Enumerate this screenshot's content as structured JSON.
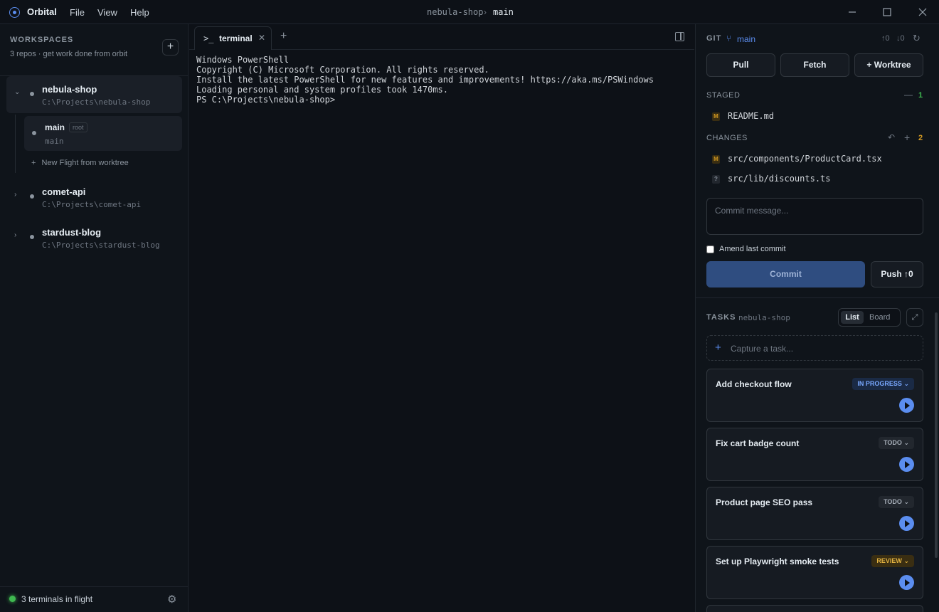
{
  "titlebar": {
    "app_name": "Orbital",
    "menus": [
      "File",
      "View",
      "Help"
    ],
    "breadcrumb_repo": "nebula-shop",
    "breadcrumb_sep": "›",
    "breadcrumb_branch": "main"
  },
  "sidebar": {
    "title": "WORKSPACES",
    "subtitle": "3 repos · get work done from orbit",
    "add_icon": "plus-icon",
    "repos": [
      {
        "name": "nebula-shop",
        "path": "C:\\Projects\\nebula-shop",
        "expanded": true
      },
      {
        "name": "comet-api",
        "path": "C:\\Projects\\comet-api",
        "expanded": false
      },
      {
        "name": "stardust-blog",
        "path": "C:\\Projects\\stardust-blog",
        "expanded": false
      }
    ],
    "branch": {
      "name": "main",
      "tag": "root",
      "sub": "main"
    },
    "new_flight": "New Flight from worktree",
    "footer": {
      "status": "3 terminals in flight",
      "status_color": "#3fb950"
    }
  },
  "terminal": {
    "tab_label": "terminal",
    "lines": [
      "Windows PowerShell",
      "Copyright (C) Microsoft Corporation. All rights reserved.",
      "",
      "Install the latest PowerShell for new features and improvements! https://aka.ms/PSWindows",
      "",
      "Loading personal and system profiles took 1470ms.",
      "PS C:\\Projects\\nebula-shop>"
    ]
  },
  "git": {
    "title": "GIT",
    "branch": "main",
    "ahead": "↑0",
    "behind": "↓0",
    "buttons": {
      "pull": "Pull",
      "fetch": "Fetch",
      "worktree": "+ Worktree"
    },
    "staged": {
      "label": "STAGED",
      "count": "1",
      "files": [
        {
          "badge": "M",
          "name": "README.md"
        }
      ]
    },
    "changes": {
      "label": "CHANGES",
      "count": "2",
      "files": [
        {
          "badge": "M",
          "name": "src/components/ProductCard.tsx"
        },
        {
          "badge": "?",
          "name": "src/lib/discounts.ts"
        }
      ]
    },
    "commit_placeholder": "Commit message...",
    "amend_label": "Amend last commit",
    "commit_label": "Commit",
    "push_label": "Push ↑0",
    "accent": "#5b8def"
  },
  "tasks": {
    "title": "TASKS",
    "repo": "nebula-shop",
    "view_list": "List",
    "view_board": "Board",
    "capture_placeholder": "Capture a task...",
    "items": [
      {
        "title": "Add checkout flow",
        "status": "IN PROGRESS",
        "kind": "prog"
      },
      {
        "title": "Fix cart badge count",
        "status": "TODO",
        "kind": "todo"
      },
      {
        "title": "Product page SEO pass",
        "status": "TODO",
        "kind": "todo"
      },
      {
        "title": "Set up Playwright smoke tests",
        "status": "REVIEW",
        "kind": "review"
      }
    ]
  }
}
